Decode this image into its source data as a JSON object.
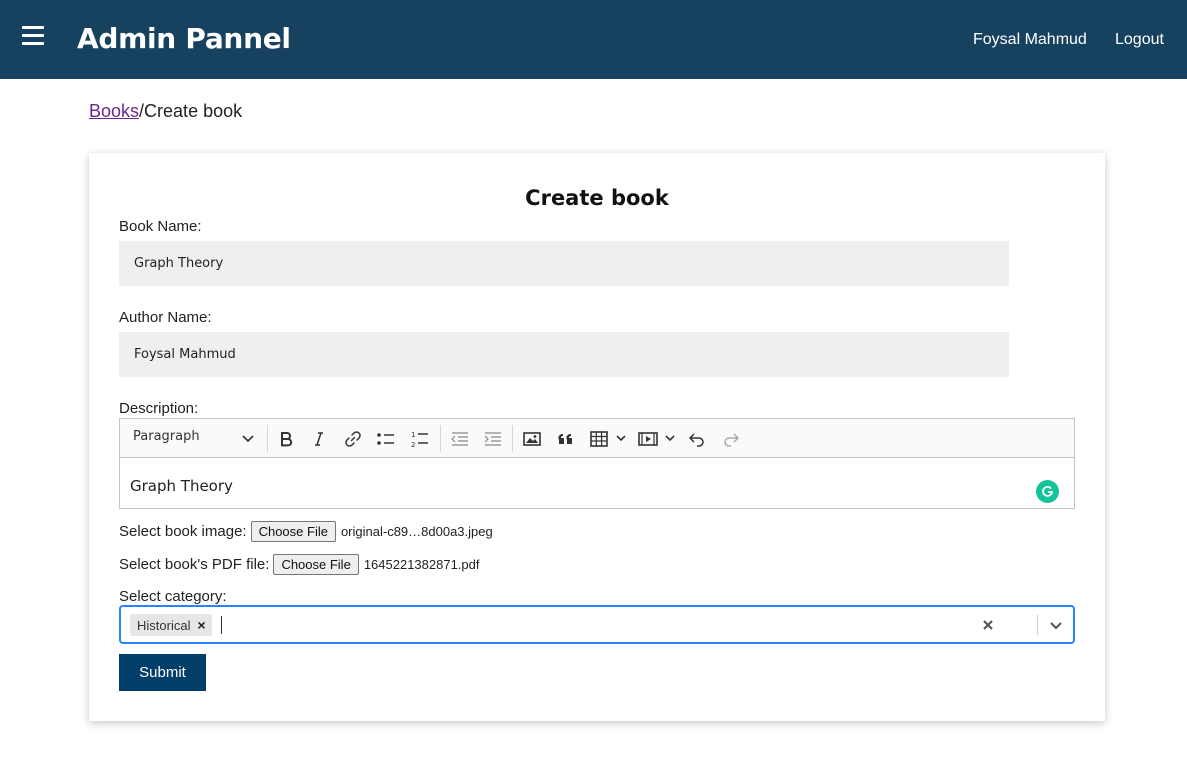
{
  "header": {
    "brand": "Admin Pannel",
    "user_name": "Foysal Mahmud",
    "logout_label": "Logout"
  },
  "breadcrumb": {
    "link": "Books",
    "separator": "/",
    "current": "Create book"
  },
  "form": {
    "title": "Create book",
    "book_name_label": "Book Name:",
    "book_name_value": "Graph Theory",
    "author_name_label": "Author Name:",
    "author_name_value": "Foysal Mahmud",
    "description_label": "Description:",
    "editor": {
      "heading_select": "Paragraph",
      "content": "Graph Theory"
    },
    "image_label": "Select book image:",
    "choose_file_label": "Choose File",
    "image_file": "original-c89…8d00a3.jpeg",
    "pdf_label": "Select book's PDF file:",
    "pdf_file": "1645221382871.pdf",
    "category_label": "Select category:",
    "selected_categories": [
      "Historical"
    ],
    "submit_label": "Submit"
  },
  "colors": {
    "header_bg": "#16425f",
    "submit_bg": "#023e6a",
    "select_focus": "#2684ff",
    "link": "#6a2a8c",
    "grammarly": "#15c39a"
  }
}
